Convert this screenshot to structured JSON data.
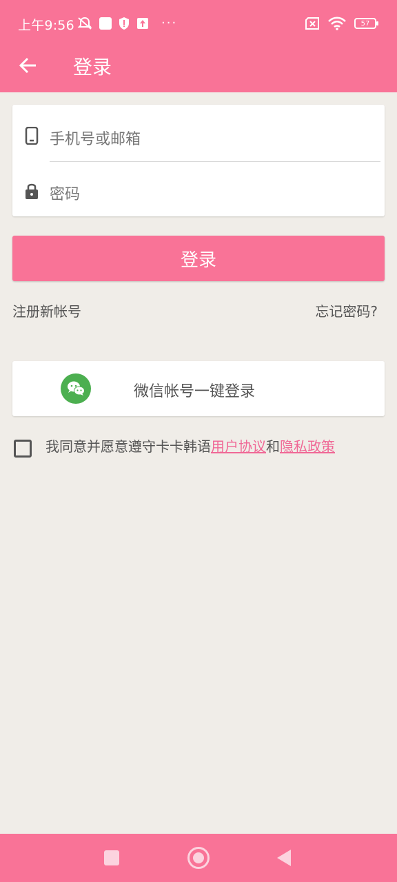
{
  "status_bar": {
    "time": "上午9:56",
    "battery": "57"
  },
  "app_bar": {
    "title": "登录"
  },
  "form": {
    "phone_placeholder": "手机号或邮箱",
    "password_placeholder": "密码"
  },
  "login_button": "登录",
  "links": {
    "register": "注册新帐号",
    "forgot": "忘记密码?"
  },
  "wechat_login": "微信帐号一键登录",
  "agreement": {
    "prefix": "我同意并愿意遵守卡卡韩语",
    "user_agreement": "用户协议",
    "and": "和",
    "privacy_policy": "隐私政策",
    "checked": false
  },
  "colors": {
    "accent": "#f97397",
    "background": "#f0ede8",
    "link": "#f06896",
    "wechat_green": "#4caf50"
  }
}
